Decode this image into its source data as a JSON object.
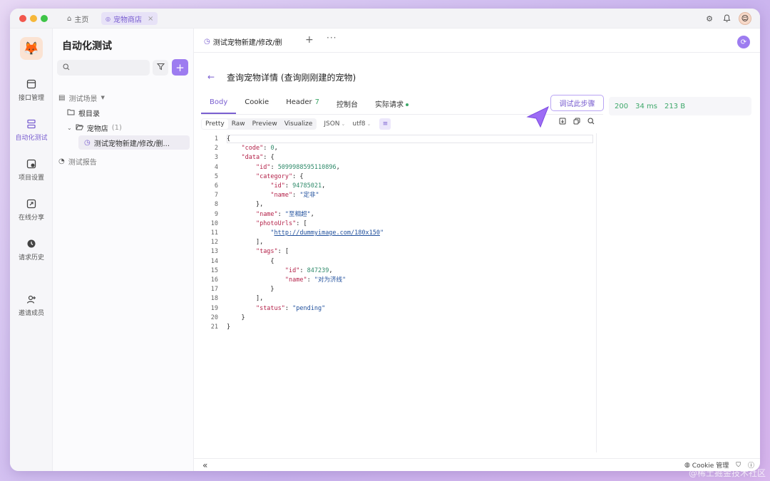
{
  "titlebar": {
    "tabs": [
      {
        "label": "主页"
      },
      {
        "label": "宠物商店"
      }
    ]
  },
  "rail": {
    "items": [
      {
        "label": "接口管理",
        "icon": "api-icon"
      },
      {
        "label": "自动化测试",
        "icon": "automation-icon"
      },
      {
        "label": "项目设置",
        "icon": "settings-icon"
      },
      {
        "label": "在线分享",
        "icon": "share-icon"
      },
      {
        "label": "请求历史",
        "icon": "history-icon"
      },
      {
        "label": "邀请成员",
        "icon": "invite-icon"
      }
    ]
  },
  "sidebar": {
    "title": "自动化测试",
    "tree": {
      "scenes": "测试场景",
      "root": "根目录",
      "folder": "宠物店",
      "folder_count": "(1)",
      "case": "测试宠物新建/修改/删...",
      "reports": "测试报告"
    }
  },
  "tabs": {
    "file_tab": "测试宠物新建/修改/删"
  },
  "page": {
    "title": "查询宠物详情 (查询刚刚建的宠物)"
  },
  "response": {
    "tabs": [
      {
        "label": "Body"
      },
      {
        "label": "Cookie"
      },
      {
        "label": "Header",
        "badge": "7"
      },
      {
        "label": "控制台"
      },
      {
        "label": "实际请求"
      }
    ],
    "debug_button": "调试此步骤",
    "view_modes": [
      "Pretty",
      "Raw",
      "Preview",
      "Visualize"
    ],
    "format": "JSON",
    "encoding": "utf8",
    "status": {
      "code": "200",
      "time": "34 ms",
      "size": "213 B"
    }
  },
  "code_lines": [
    {
      "n": "1",
      "t": "{"
    },
    {
      "n": "2",
      "t": "    \"code\": 0,"
    },
    {
      "n": "3",
      "t": "    \"data\": {"
    },
    {
      "n": "4",
      "t": "        \"id\": 5099988595110896,"
    },
    {
      "n": "5",
      "t": "        \"category\": {"
    },
    {
      "n": "6",
      "t": "            \"id\": 94785021,"
    },
    {
      "n": "7",
      "t": "            \"name\": \"定非\""
    },
    {
      "n": "8",
      "t": "        },"
    },
    {
      "n": "9",
      "t": "        \"name\": \"至相超\","
    },
    {
      "n": "10",
      "t": "        \"photoUrls\": ["
    },
    {
      "n": "11",
      "t": "            \"http://dummyimage.com/180x150\""
    },
    {
      "n": "12",
      "t": "        ],"
    },
    {
      "n": "13",
      "t": "        \"tags\": ["
    },
    {
      "n": "14",
      "t": "            {"
    },
    {
      "n": "15",
      "t": "                \"id\": 847239,"
    },
    {
      "n": "16",
      "t": "                \"name\": \"对为济线\""
    },
    {
      "n": "17",
      "t": "            }"
    },
    {
      "n": "18",
      "t": "        ],"
    },
    {
      "n": "19",
      "t": "        \"status\": \"pending\""
    },
    {
      "n": "20",
      "t": "    }"
    },
    {
      "n": "21",
      "t": "}"
    }
  ],
  "bottom": {
    "cookie_manage": "Cookie 管理"
  },
  "watermark": "@稀土掘金技术社区"
}
